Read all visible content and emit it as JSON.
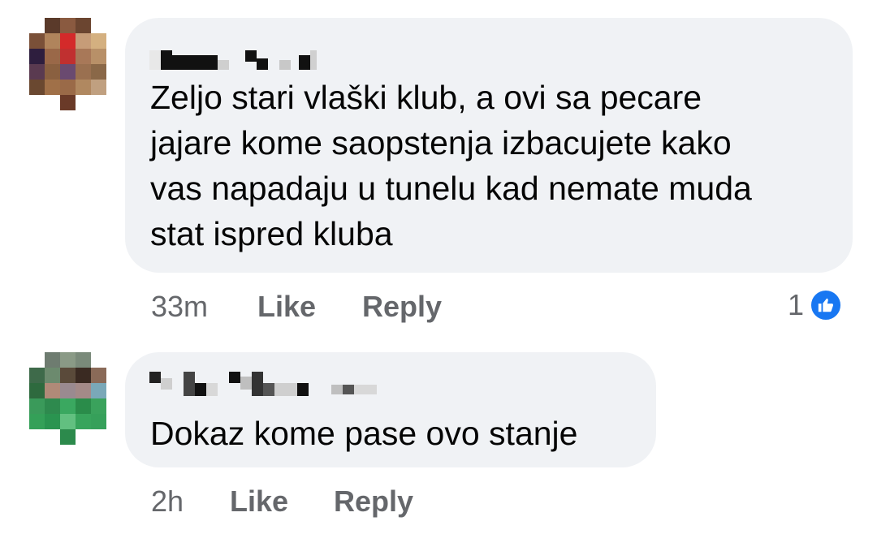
{
  "comments": [
    {
      "author": "",
      "text": "Zeljo stari vlaški klub, a ovi sa pecare\njajare kome saopstenja izbacujete kako\nvas napadaju u tunelu kad nemate muda\nstat ispred kluba",
      "time": "33m",
      "like_label": "Like",
      "reply_label": "Reply",
      "reaction_count": "1",
      "reaction_icon": "thumbs-up-icon",
      "reaction_color": "#1877f2"
    },
    {
      "author": "",
      "text": "Dokaz kome pase ovo stanje",
      "time": "2h",
      "like_label": "Like",
      "reply_label": "Reply"
    }
  ],
  "colors": {
    "bubble": "#f0f2f5",
    "text": "#050505",
    "secondary_text": "#65676b",
    "accent": "#1877f2"
  }
}
